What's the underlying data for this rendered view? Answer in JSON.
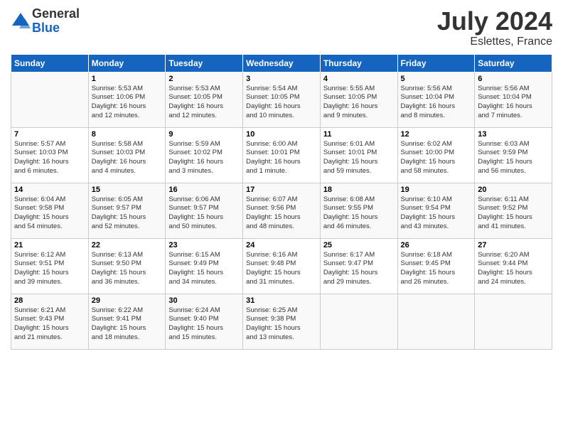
{
  "header": {
    "logo_general": "General",
    "logo_blue": "Blue",
    "month": "July 2024",
    "location": "Eslettes, France"
  },
  "weekdays": [
    "Sunday",
    "Monday",
    "Tuesday",
    "Wednesday",
    "Thursday",
    "Friday",
    "Saturday"
  ],
  "weeks": [
    [
      {
        "day": "",
        "info": ""
      },
      {
        "day": "1",
        "info": "Sunrise: 5:53 AM\nSunset: 10:06 PM\nDaylight: 16 hours\nand 12 minutes."
      },
      {
        "day": "2",
        "info": "Sunrise: 5:53 AM\nSunset: 10:05 PM\nDaylight: 16 hours\nand 12 minutes."
      },
      {
        "day": "3",
        "info": "Sunrise: 5:54 AM\nSunset: 10:05 PM\nDaylight: 16 hours\nand 10 minutes."
      },
      {
        "day": "4",
        "info": "Sunrise: 5:55 AM\nSunset: 10:05 PM\nDaylight: 16 hours\nand 9 minutes."
      },
      {
        "day": "5",
        "info": "Sunrise: 5:56 AM\nSunset: 10:04 PM\nDaylight: 16 hours\nand 8 minutes."
      },
      {
        "day": "6",
        "info": "Sunrise: 5:56 AM\nSunset: 10:04 PM\nDaylight: 16 hours\nand 7 minutes."
      }
    ],
    [
      {
        "day": "7",
        "info": "Sunrise: 5:57 AM\nSunset: 10:03 PM\nDaylight: 16 hours\nand 6 minutes."
      },
      {
        "day": "8",
        "info": "Sunrise: 5:58 AM\nSunset: 10:03 PM\nDaylight: 16 hours\nand 4 minutes."
      },
      {
        "day": "9",
        "info": "Sunrise: 5:59 AM\nSunset: 10:02 PM\nDaylight: 16 hours\nand 3 minutes."
      },
      {
        "day": "10",
        "info": "Sunrise: 6:00 AM\nSunset: 10:01 PM\nDaylight: 16 hours\nand 1 minute."
      },
      {
        "day": "11",
        "info": "Sunrise: 6:01 AM\nSunset: 10:01 PM\nDaylight: 15 hours\nand 59 minutes."
      },
      {
        "day": "12",
        "info": "Sunrise: 6:02 AM\nSunset: 10:00 PM\nDaylight: 15 hours\nand 58 minutes."
      },
      {
        "day": "13",
        "info": "Sunrise: 6:03 AM\nSunset: 9:59 PM\nDaylight: 15 hours\nand 56 minutes."
      }
    ],
    [
      {
        "day": "14",
        "info": "Sunrise: 6:04 AM\nSunset: 9:58 PM\nDaylight: 15 hours\nand 54 minutes."
      },
      {
        "day": "15",
        "info": "Sunrise: 6:05 AM\nSunset: 9:57 PM\nDaylight: 15 hours\nand 52 minutes."
      },
      {
        "day": "16",
        "info": "Sunrise: 6:06 AM\nSunset: 9:57 PM\nDaylight: 15 hours\nand 50 minutes."
      },
      {
        "day": "17",
        "info": "Sunrise: 6:07 AM\nSunset: 9:56 PM\nDaylight: 15 hours\nand 48 minutes."
      },
      {
        "day": "18",
        "info": "Sunrise: 6:08 AM\nSunset: 9:55 PM\nDaylight: 15 hours\nand 46 minutes."
      },
      {
        "day": "19",
        "info": "Sunrise: 6:10 AM\nSunset: 9:54 PM\nDaylight: 15 hours\nand 43 minutes."
      },
      {
        "day": "20",
        "info": "Sunrise: 6:11 AM\nSunset: 9:52 PM\nDaylight: 15 hours\nand 41 minutes."
      }
    ],
    [
      {
        "day": "21",
        "info": "Sunrise: 6:12 AM\nSunset: 9:51 PM\nDaylight: 15 hours\nand 39 minutes."
      },
      {
        "day": "22",
        "info": "Sunrise: 6:13 AM\nSunset: 9:50 PM\nDaylight: 15 hours\nand 36 minutes."
      },
      {
        "day": "23",
        "info": "Sunrise: 6:15 AM\nSunset: 9:49 PM\nDaylight: 15 hours\nand 34 minutes."
      },
      {
        "day": "24",
        "info": "Sunrise: 6:16 AM\nSunset: 9:48 PM\nDaylight: 15 hours\nand 31 minutes."
      },
      {
        "day": "25",
        "info": "Sunrise: 6:17 AM\nSunset: 9:47 PM\nDaylight: 15 hours\nand 29 minutes."
      },
      {
        "day": "26",
        "info": "Sunrise: 6:18 AM\nSunset: 9:45 PM\nDaylight: 15 hours\nand 26 minutes."
      },
      {
        "day": "27",
        "info": "Sunrise: 6:20 AM\nSunset: 9:44 PM\nDaylight: 15 hours\nand 24 minutes."
      }
    ],
    [
      {
        "day": "28",
        "info": "Sunrise: 6:21 AM\nSunset: 9:43 PM\nDaylight: 15 hours\nand 21 minutes."
      },
      {
        "day": "29",
        "info": "Sunrise: 6:22 AM\nSunset: 9:41 PM\nDaylight: 15 hours\nand 18 minutes."
      },
      {
        "day": "30",
        "info": "Sunrise: 6:24 AM\nSunset: 9:40 PM\nDaylight: 15 hours\nand 15 minutes."
      },
      {
        "day": "31",
        "info": "Sunrise: 6:25 AM\nSunset: 9:38 PM\nDaylight: 15 hours\nand 13 minutes."
      },
      {
        "day": "",
        "info": ""
      },
      {
        "day": "",
        "info": ""
      },
      {
        "day": "",
        "info": ""
      }
    ]
  ]
}
